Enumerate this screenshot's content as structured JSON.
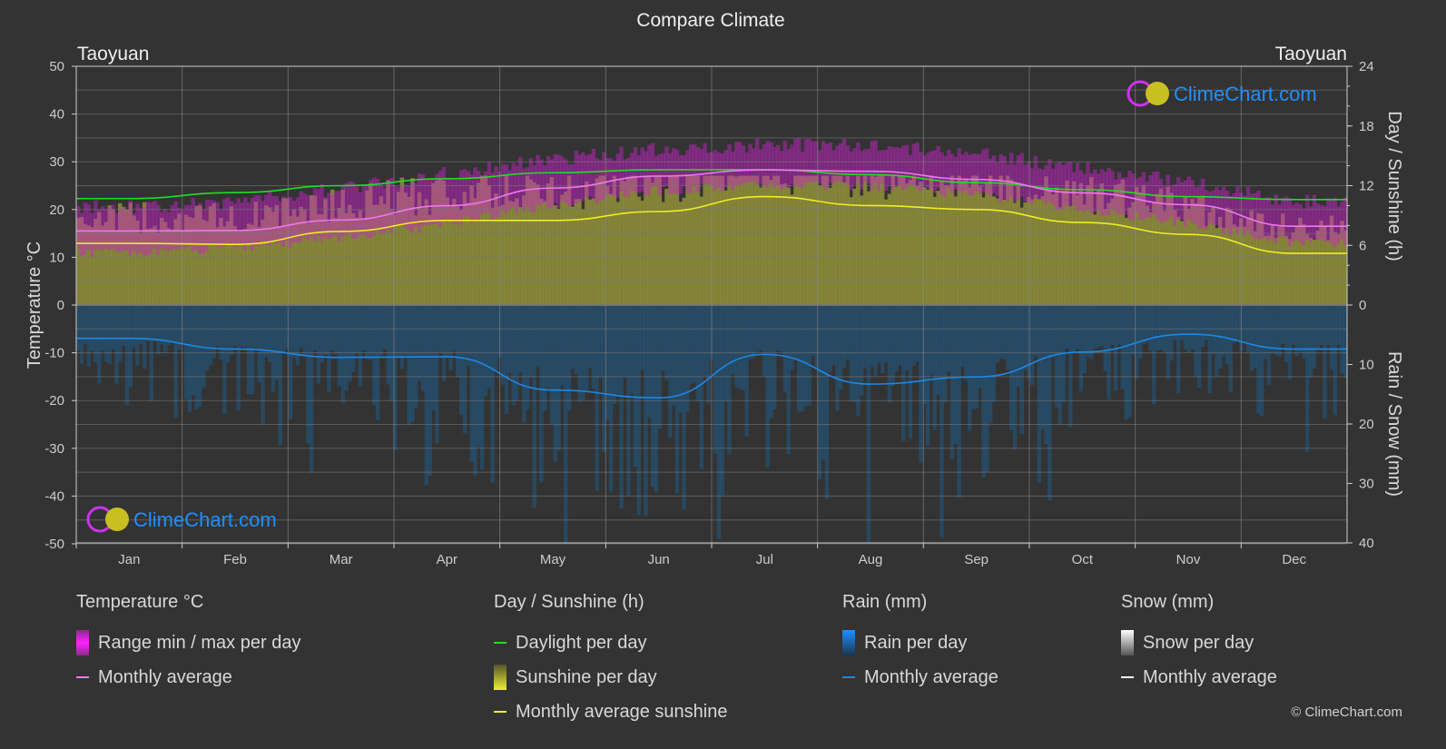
{
  "title": "Compare Climate",
  "location_left": "Taoyuan",
  "location_right": "Taoyuan",
  "watermark": "ClimeChart.com",
  "copyright": "© ClimeChart.com",
  "colors": {
    "background": "#333333",
    "daylight": "#22dd22",
    "temp_avg": "#ee77ee",
    "temp_range": "#cc22cc",
    "sunshine_avg": "#eeee22",
    "sunshine_fill": "#8f8f3a",
    "rain_avg": "#1e88e5",
    "rain_fill": "#1f5a85",
    "snow_avg": "#ffffff",
    "brand": "#1e90ff"
  },
  "chart_data": {
    "type": "line",
    "title": "Compare Climate",
    "categories": [
      "Jan",
      "Feb",
      "Mar",
      "Apr",
      "May",
      "Jun",
      "Jul",
      "Aug",
      "Sep",
      "Oct",
      "Nov",
      "Dec"
    ],
    "axes": {
      "left": {
        "label": "Temperature °C",
        "range": [
          -50,
          50
        ],
        "ticks": [
          50,
          40,
          30,
          20,
          10,
          0,
          -10,
          -20,
          -30,
          -40,
          -50
        ]
      },
      "right_top": {
        "label": "Day / Sunshine (h)",
        "range": [
          0,
          24
        ],
        "ticks": [
          24,
          18,
          12,
          6,
          0
        ]
      },
      "right_bottom": {
        "label": "Rain / Snow (mm)",
        "range": [
          0,
          40
        ],
        "ticks": [
          0,
          10,
          20,
          30,
          40
        ]
      }
    },
    "grid": true,
    "series": [
      {
        "name": "Daylight per day",
        "axis": "right_top",
        "unit": "h",
        "values": [
          10.7,
          11.3,
          12.0,
          12.7,
          13.3,
          13.6,
          13.6,
          13.1,
          12.3,
          11.6,
          10.9,
          10.6
        ]
      },
      {
        "name": "Temperature monthly average",
        "axis": "left",
        "unit": "°C",
        "values": [
          15.5,
          15.6,
          17.8,
          20.8,
          24.5,
          27.0,
          28.3,
          28.0,
          26.3,
          23.5,
          21.0,
          16.5
        ]
      },
      {
        "name": "Temperature range max (approx)",
        "axis": "left",
        "unit": "°C",
        "values": [
          20,
          21,
          24,
          27,
          30,
          32,
          33,
          33,
          31,
          28,
          25,
          21
        ]
      },
      {
        "name": "Temperature range min (approx)",
        "axis": "left",
        "unit": "°C",
        "values": [
          12,
          13,
          15,
          18,
          22,
          25,
          26,
          26,
          24,
          21,
          18,
          14
        ]
      },
      {
        "name": "Monthly average sunshine",
        "axis": "right_top",
        "unit": "h",
        "values": [
          6.2,
          6.1,
          7.4,
          8.5,
          8.5,
          9.4,
          10.9,
          10.0,
          9.6,
          8.3,
          7.1,
          5.2
        ]
      },
      {
        "name": "Rain monthly average",
        "axis": "right_bottom",
        "unit": "mm",
        "values": [
          5.6,
          7.4,
          8.8,
          8.7,
          14.3,
          15.6,
          8.3,
          13.3,
          12.1,
          7.9,
          4.9,
          7.4
        ]
      }
    ]
  },
  "legend": {
    "temperature": {
      "header": "Temperature °C",
      "items": [
        "Range min / max per day",
        "Monthly average"
      ]
    },
    "sunshine": {
      "header": "Day / Sunshine (h)",
      "items": [
        "Daylight per day",
        "Sunshine per day",
        "Monthly average sunshine"
      ]
    },
    "rain": {
      "header": "Rain (mm)",
      "items": [
        "Rain per day",
        "Monthly average"
      ]
    },
    "snow": {
      "header": "Snow (mm)",
      "items": [
        "Snow per day",
        "Monthly average"
      ]
    }
  }
}
